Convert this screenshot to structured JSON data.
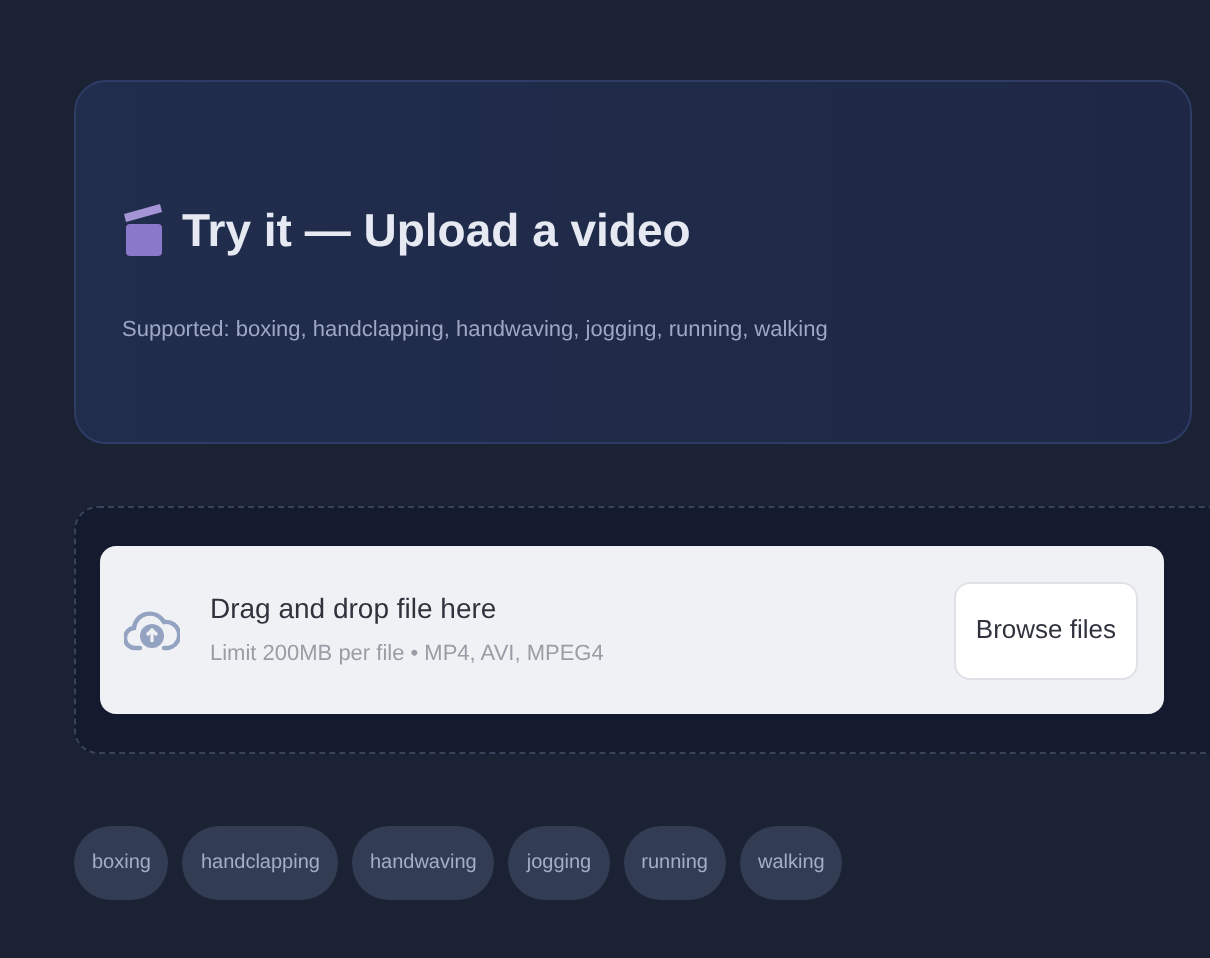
{
  "hero": {
    "title": "Try it — Upload a video",
    "subtitle": "Supported: boxing, handclapping, handwaving, jogging, running, walking"
  },
  "uploader": {
    "instruction": "Drag and drop file here",
    "limit": "Limit 200MB per file • MP4, AVI, MPEG4",
    "button": "Browse files"
  },
  "tags": [
    "boxing",
    "handclapping",
    "handwaving",
    "jogging",
    "running",
    "walking"
  ]
}
